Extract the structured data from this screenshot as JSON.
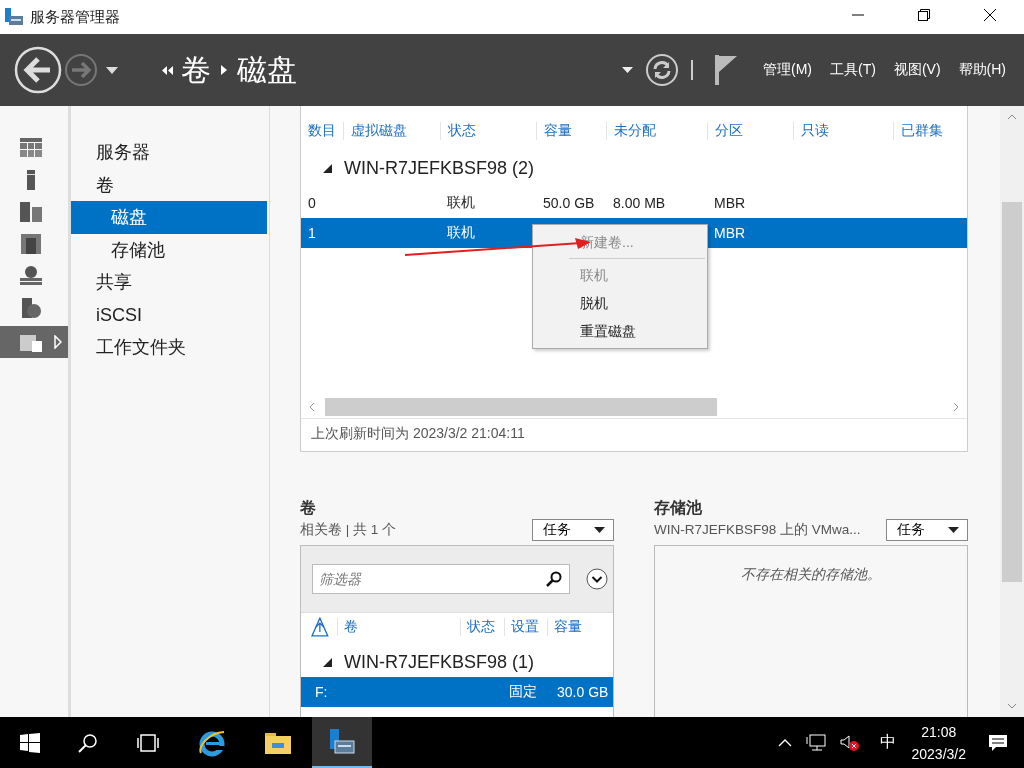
{
  "window": {
    "title": "服务器管理器"
  },
  "header": {
    "breadcrumb": [
      {
        "label": "卷"
      },
      {
        "label": "磁盘"
      }
    ],
    "menus": [
      "管理(M)",
      "工具(T)",
      "视图(V)",
      "帮助(H)"
    ]
  },
  "rail": [
    {
      "selected": false
    },
    {
      "selected": false
    },
    {
      "selected": false
    },
    {
      "selected": false
    },
    {
      "selected": false
    },
    {
      "selected": false
    },
    {
      "selected": true
    }
  ],
  "nav": [
    {
      "label": "服务器",
      "selected": false
    },
    {
      "label": "卷",
      "selected": false,
      "children": [
        {
          "label": "磁盘",
          "selected": true
        },
        {
          "label": "存储池",
          "selected": false
        }
      ]
    },
    {
      "label": "共享",
      "selected": false
    },
    {
      "label": "iSCSI",
      "selected": false
    },
    {
      "label": "工作文件夹",
      "selected": false
    }
  ],
  "disks": {
    "columns": [
      "数目",
      "虚拟磁盘",
      "状态",
      "容量",
      "未分配",
      "分区",
      "只读",
      "已群集"
    ],
    "group": "WIN-R7JEFKBSF98 (2)",
    "rows": [
      {
        "number": "0",
        "status": "联机",
        "capacity": "50.0 GB",
        "unallocated": "8.00 MB",
        "partition": "MBR",
        "selected": false
      },
      {
        "number": "1",
        "status": "联机",
        "partition": "MBR",
        "selected": true
      }
    ],
    "refreshed": "上次刷新时间为 2023/3/2 21:04:11"
  },
  "context_menu": {
    "items": [
      {
        "kind": "item",
        "label": "新建卷...",
        "disabled": true
      },
      {
        "kind": "separator"
      },
      {
        "kind": "item",
        "label": "联机",
        "disabled": true
      },
      {
        "kind": "item",
        "label": "脱机",
        "disabled": false
      },
      {
        "kind": "item",
        "label": "重置磁盘",
        "disabled": false
      }
    ]
  },
  "volumes": {
    "title": "卷",
    "subtitle": "相关卷 | 共 1 个",
    "tasks": "任务",
    "filter": {
      "placeholder": "筛选器"
    },
    "columns": [
      "卷",
      "状态",
      "设置",
      "容量"
    ],
    "group": "WIN-R7JEFKBSF98 (1)",
    "rows": [
      {
        "volume": "F:",
        "setting": "固定",
        "capacity": "30.0 GB",
        "selected": true
      }
    ]
  },
  "pools": {
    "title": "存储池",
    "subtitle": "WIN-R7JEFKBSF98 上的 VMwa...",
    "tasks": "任务",
    "empty_message": "不存在相关的存储池。"
  },
  "taskbar": {
    "ime": "中",
    "time": "21:08",
    "date": "2023/3/2"
  }
}
